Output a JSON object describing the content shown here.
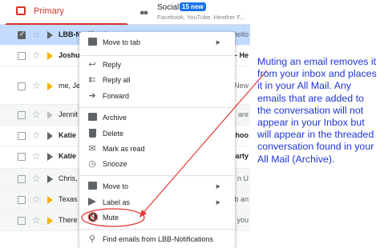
{
  "tabs": {
    "primary": "Primary",
    "social": "Social",
    "social_badge": "15 new",
    "social_sub": "Facebook, YouTube, Heather F..."
  },
  "rows": [
    {
      "sender": "LBB-Notification",
      "snippet": "Hello",
      "selected": true
    },
    {
      "sender": "Joshu",
      "snippet": "- He"
    },
    {
      "sender": "me, Je",
      "snippet": "New"
    },
    {
      "sender": "Jennit",
      "snippet": "are"
    },
    {
      "sender": "Katie",
      "snippet": "hoo"
    },
    {
      "sender": "Katie",
      "snippet": "arty"
    },
    {
      "sender": "Chris,",
      "snippet": "n U"
    },
    {
      "sender": "Texas",
      "snippet": "b an"
    },
    {
      "sender": "There",
      "snippet": "you"
    }
  ],
  "menu": {
    "move_to_tab": "Move to tab",
    "reply": "Reply",
    "reply_all": "Reply all",
    "forward": "Forward",
    "archive": "Archive",
    "delete": "Delete",
    "mark_as_read": "Mark as read",
    "snooze": "Snooze",
    "move_to": "Move to",
    "label_as": "Label as",
    "mute": "Mute",
    "find_emails": "Find emails from LBB-Notifications"
  },
  "annotation": {
    "text": "Muting an email removes it from your inbox and places it in your All Mail. Any emails that are added to the conversation will not appear in your Inbox but will appear in the threaded conversation found in your All Mail (Archive).",
    "color": "#1f35d6",
    "arrow_color": "#e53935"
  }
}
